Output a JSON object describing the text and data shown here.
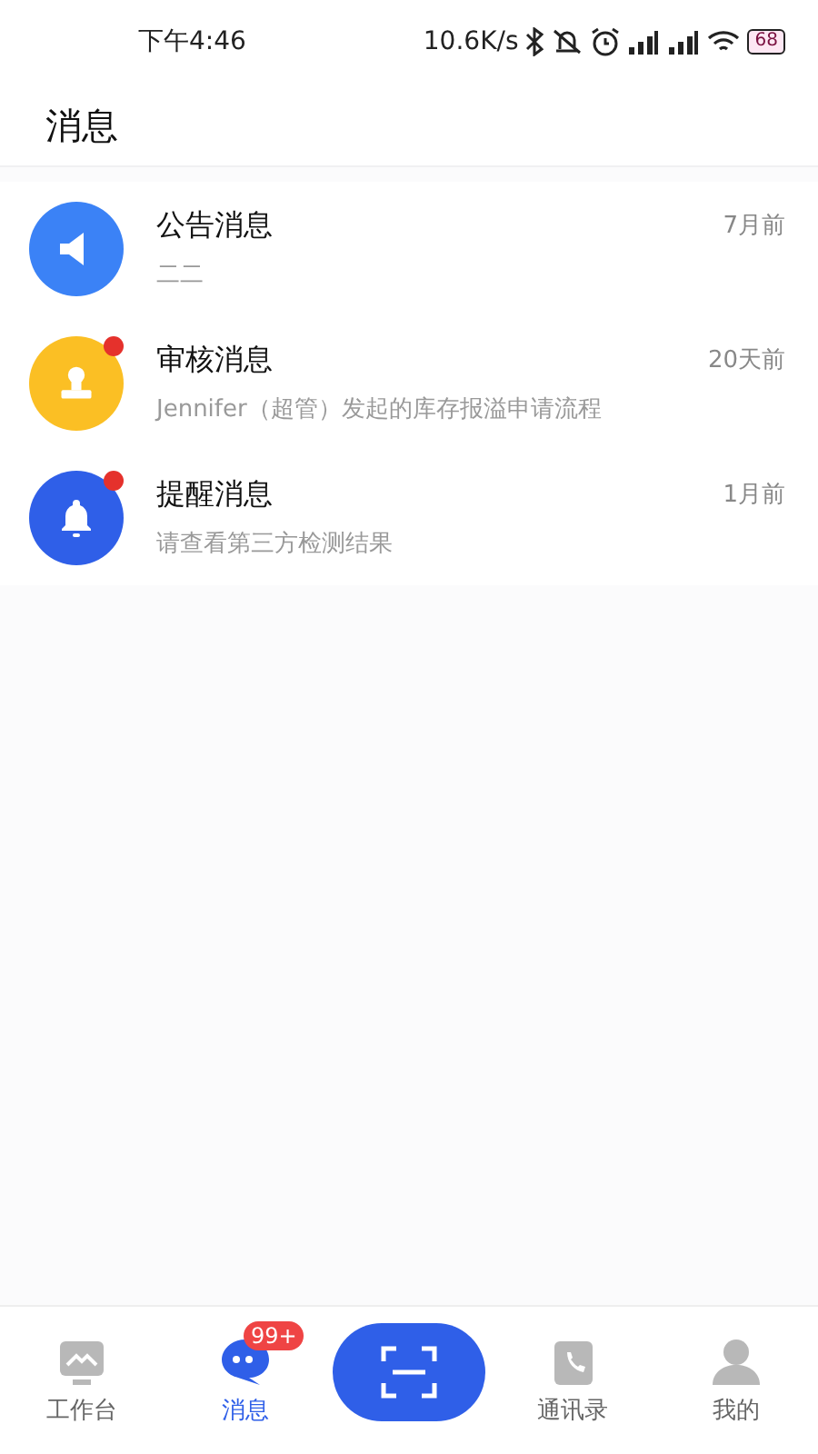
{
  "status_bar": {
    "time": "下午4:46",
    "speed": "10.6K/s",
    "battery": "68"
  },
  "header": {
    "title": "消息"
  },
  "messages": [
    {
      "kind": "announcement",
      "color": "#3b82f6",
      "title": "公告消息",
      "preview": "二二",
      "time": "7月前",
      "unread": false
    },
    {
      "kind": "approval",
      "color": "#fbbf24",
      "title": "审核消息",
      "preview": "Jennifer（超管）发起的库存报溢申请流程",
      "time": "20天前",
      "unread": true
    },
    {
      "kind": "reminder",
      "color": "#2f5fe8",
      "title": "提醒消息",
      "preview": "请查看第三方检测结果",
      "time": "1月前",
      "unread": true
    }
  ],
  "tabs": [
    {
      "kind": "workbench",
      "label": "工作台",
      "selected": false
    },
    {
      "kind": "messages",
      "label": "消息",
      "selected": true,
      "badge": "99+"
    },
    {
      "kind": "scan",
      "selected": false
    },
    {
      "kind": "contacts",
      "label": "通讯录",
      "selected": false
    },
    {
      "kind": "profile",
      "label": "我的",
      "selected": false
    }
  ]
}
